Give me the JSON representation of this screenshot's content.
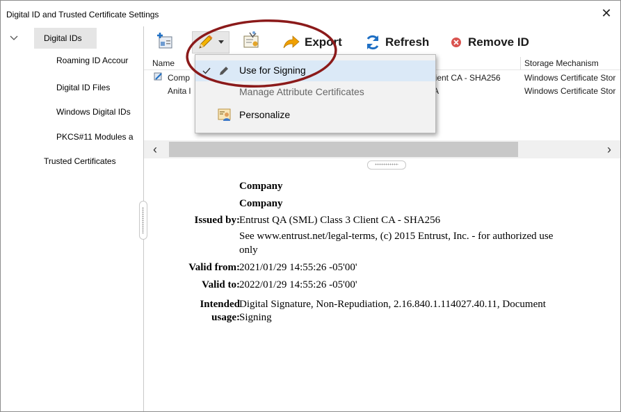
{
  "window": {
    "title": "Digital ID and Trusted Certificate Settings",
    "close_glyph": "✕"
  },
  "tree": {
    "root_label": "Digital IDs",
    "children": [
      "Roaming ID Accour",
      "Digital ID Files",
      "Windows Digital IDs",
      "PKCS#11 Modules a"
    ],
    "trusted_label": "Trusted Certificates"
  },
  "toolbar": {
    "export_label": "Export",
    "refresh_label": "Refresh",
    "remove_label": "Remove ID"
  },
  "table": {
    "col_name": "Name",
    "col_storage": "Storage Mechanism",
    "rows": [
      {
        "name": "Comp",
        "issuer": "lient CA - SHA256",
        "storage": "Windows Certificate Stor"
      },
      {
        "name": "Anita l",
        "issuer": "A",
        "storage": "Windows Certificate Stor"
      }
    ]
  },
  "menu": {
    "items": [
      {
        "label": "Use for Signing",
        "checked": true
      },
      {
        "label": "Manage Attribute Certificates",
        "checked": false
      },
      {
        "label": "Personalize",
        "checked": false
      }
    ]
  },
  "details": {
    "line1": "Company",
    "line2": "Company",
    "issued_by_label": "Issued by:",
    "issued_by_value": "Entrust QA (SML) Class 3 Client CA - SHA256",
    "issued_by_extra1": "See www.entrust.net/legal-terms, (c) 2015 Entrust, Inc. - for authorized use",
    "issued_by_extra2": "only",
    "valid_from_label": "Valid from:",
    "valid_from_value": "2021/01/29 14:55:26 -05'00'",
    "valid_to_label": "Valid to:",
    "valid_to_value": "2022/01/29 14:55:26 -05'00'",
    "intended_label1": "Intended",
    "intended_label2": "usage:",
    "intended_value1": "Digital Signature, Non-Repudiation, 2.16.840.1.114027.40.11, Document",
    "intended_value2": "Signing"
  },
  "colors": {
    "annotation_ellipse": "#8b1a1a",
    "menu_highlight": "#dbe9f7",
    "refresh_blue": "#1e6fc4",
    "export_orange": "#f0a000",
    "remove_red": "#c0392b"
  }
}
